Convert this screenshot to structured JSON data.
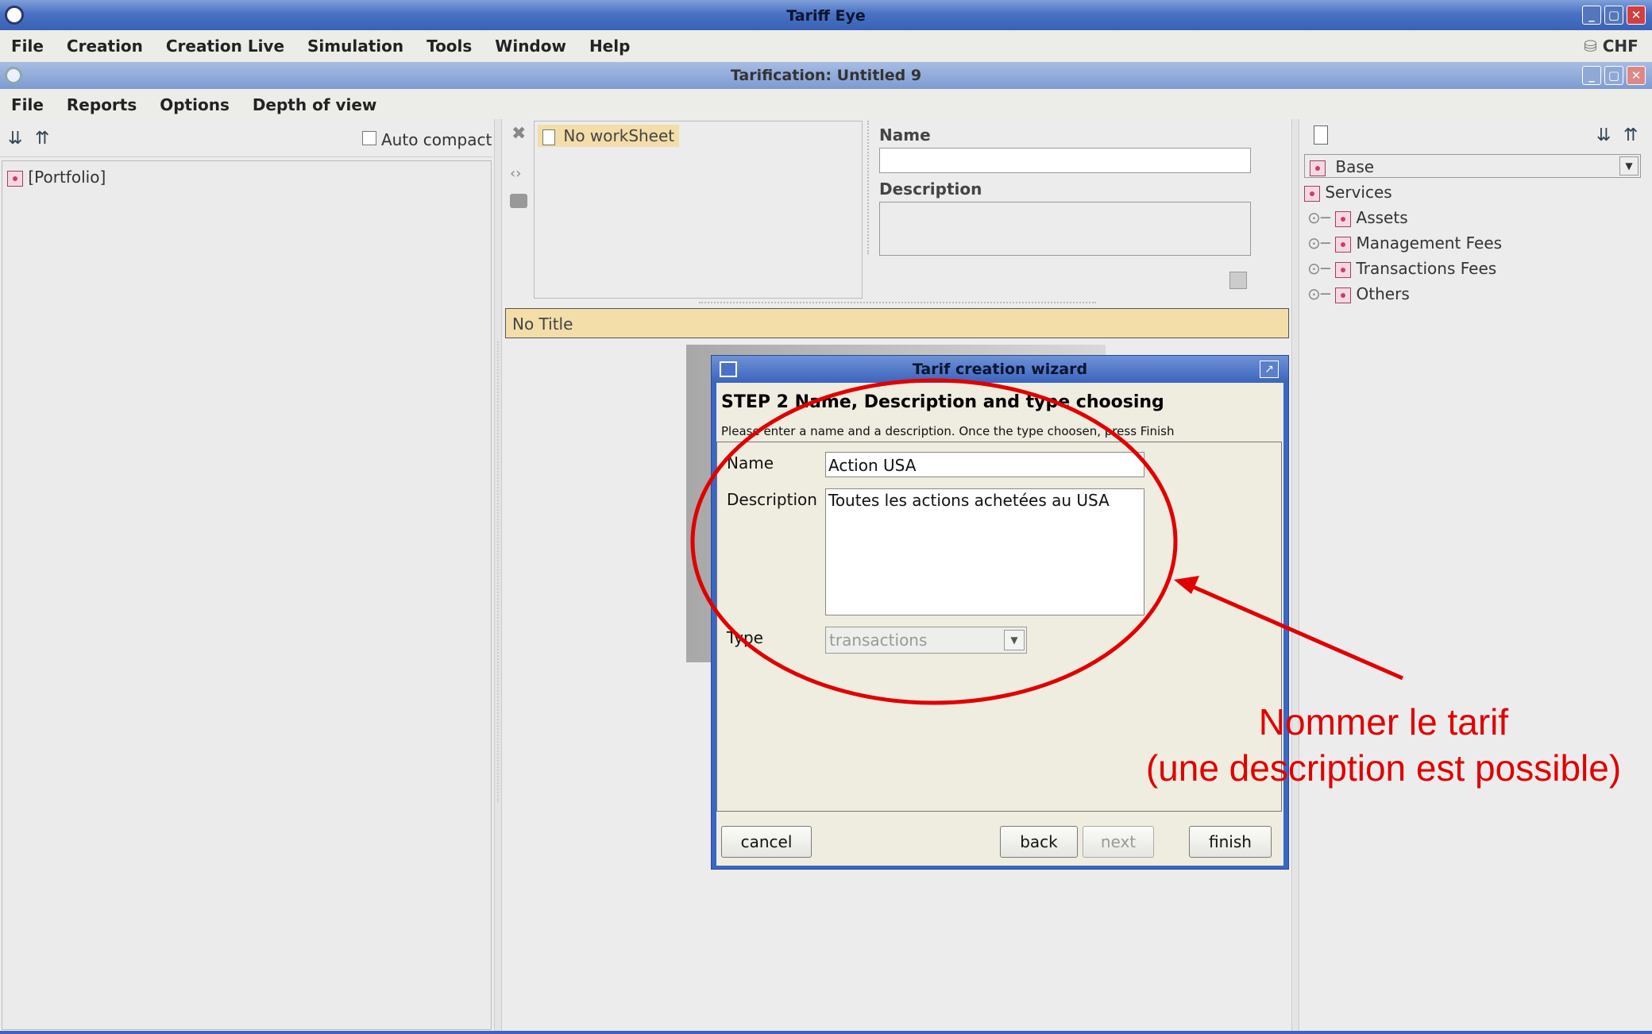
{
  "app": {
    "title": "Tariff Eye",
    "currency": "CHF",
    "menu": [
      "File",
      "Creation",
      "Creation Live",
      "Simulation",
      "Tools",
      "Window",
      "Help"
    ]
  },
  "inner_window": {
    "title": "Tarification: Untitled 9",
    "menu": [
      "File",
      "Reports",
      "Options",
      "Depth of view"
    ]
  },
  "left_panel": {
    "auto_compact": "Auto compact",
    "tree_root": "[Portfolio]"
  },
  "center": {
    "worksheet_label": "No workSheet",
    "name_label": "Name",
    "description_label": "Description",
    "title_bar": "No Title"
  },
  "right_panel": {
    "combo_value": "Base",
    "tree_root": "Services",
    "tree_items": [
      "Assets",
      "Management Fees",
      "Transactions Fees",
      "Others"
    ]
  },
  "wizard": {
    "title": "Tarif creation wizard",
    "step_title": "STEP 2  Name, Description and type choosing",
    "instructions": "Please enter a name and a description. Once the type choosen, press Finish",
    "name_label": "Name",
    "name_value": "Action USA",
    "description_label": "Description",
    "description_value": "Toutes les actions achetées au USA",
    "type_label": "Type",
    "type_value": "transactions",
    "cancel": "cancel",
    "back": "back",
    "next": "next",
    "finish": "finish"
  },
  "annotation": {
    "line1": "Nommer le tarif",
    "line2": "(une description est possible)",
    "color": "#e00000"
  }
}
